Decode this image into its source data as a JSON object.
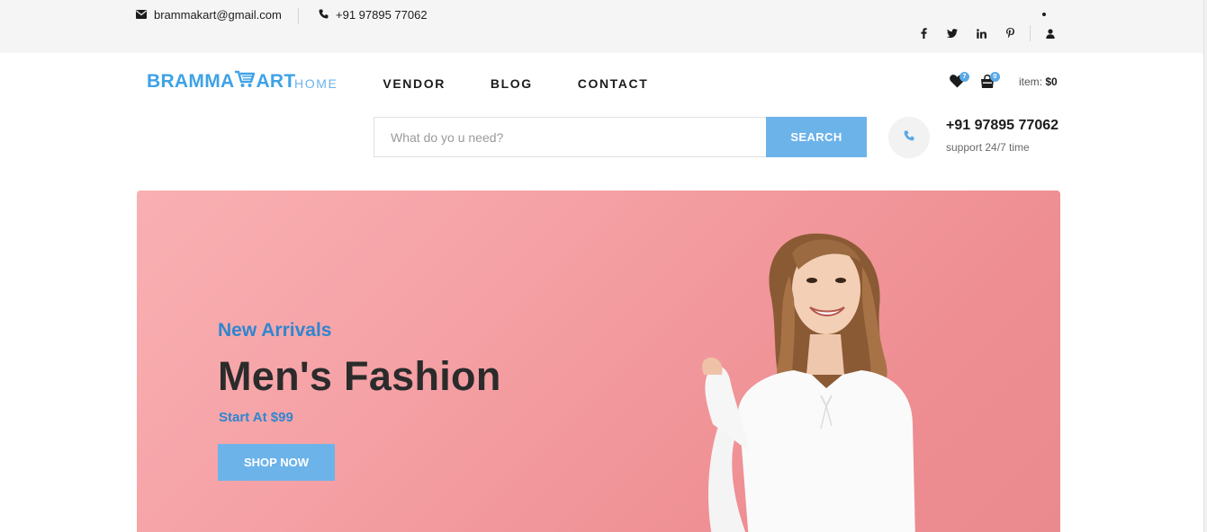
{
  "topbar": {
    "email": "brammakart@gmail.com",
    "phone": "+91 97895 77062",
    "socials": [
      {
        "name": "facebook-icon",
        "glyph": "f"
      },
      {
        "name": "twitter-icon",
        "glyph": "t"
      },
      {
        "name": "linkedin-icon",
        "glyph": "in"
      },
      {
        "name": "pinterest-icon",
        "glyph": "p"
      }
    ]
  },
  "header": {
    "logo": {
      "left": "BRAMMA",
      "right": "ART"
    },
    "nav": [
      "HOME",
      "VENDOR",
      "BLOG",
      "CONTACT"
    ],
    "active_nav": "HOME",
    "wishlist_count": "7",
    "cart_count": "0",
    "item_label": "item:",
    "item_total": "$0"
  },
  "search": {
    "placeholder": "What do yo u need?",
    "value": "",
    "button_label": "SEARCH"
  },
  "support": {
    "phone": "+91 97895 77062",
    "text": "support 24/7 time"
  },
  "hero": {
    "eyebrow": "New Arrivals",
    "title": "Men's Fashion",
    "price": "Start At $99",
    "button_label": "SHOP NOW"
  },
  "colors": {
    "accent": "#6cb3ea",
    "brand_blue": "#3fa2e6",
    "hero_text_blue": "#2f86cf",
    "hero_bg": "#f5a1a5",
    "dark_text": "#1c1c1c"
  }
}
